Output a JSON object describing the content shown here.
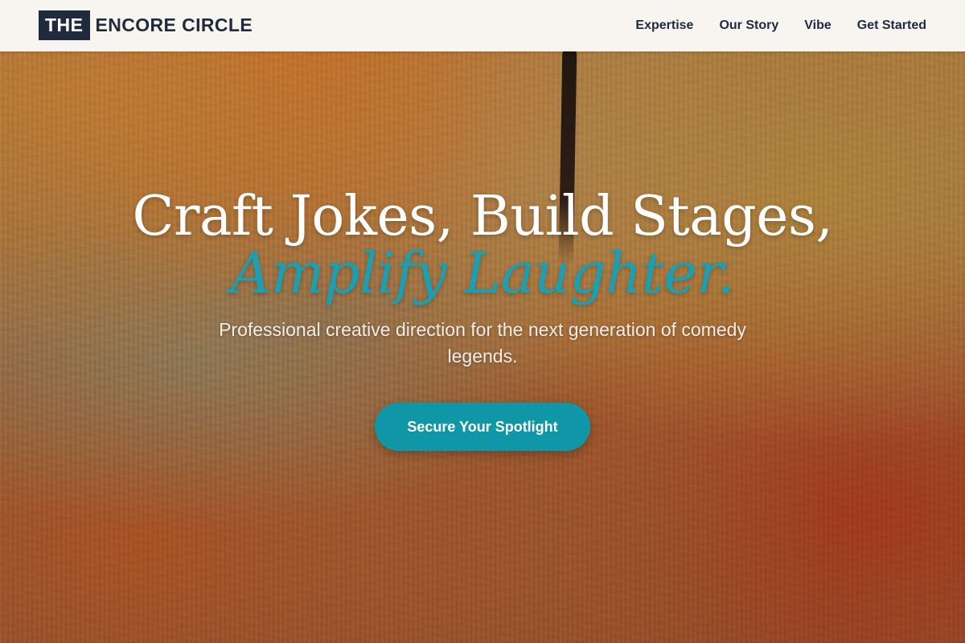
{
  "brand": {
    "badge": "THE",
    "name": "ENCORE CIRCLE"
  },
  "nav": {
    "items": [
      {
        "label": "Expertise"
      },
      {
        "label": "Our Story"
      },
      {
        "label": "Vibe"
      },
      {
        "label": "Get Started"
      }
    ]
  },
  "hero": {
    "headline": "Craft Jokes, Build Stages,",
    "headline_accent": "Amplify Laughter.",
    "subhead": "Professional creative direction for the next generation of comedy legends.",
    "cta_label": "Secure Your Spotlight"
  },
  "colors": {
    "brand_navy": "#1f2a3c",
    "accent_teal": "#1aa0b2",
    "cta_teal": "#0f97a8"
  }
}
